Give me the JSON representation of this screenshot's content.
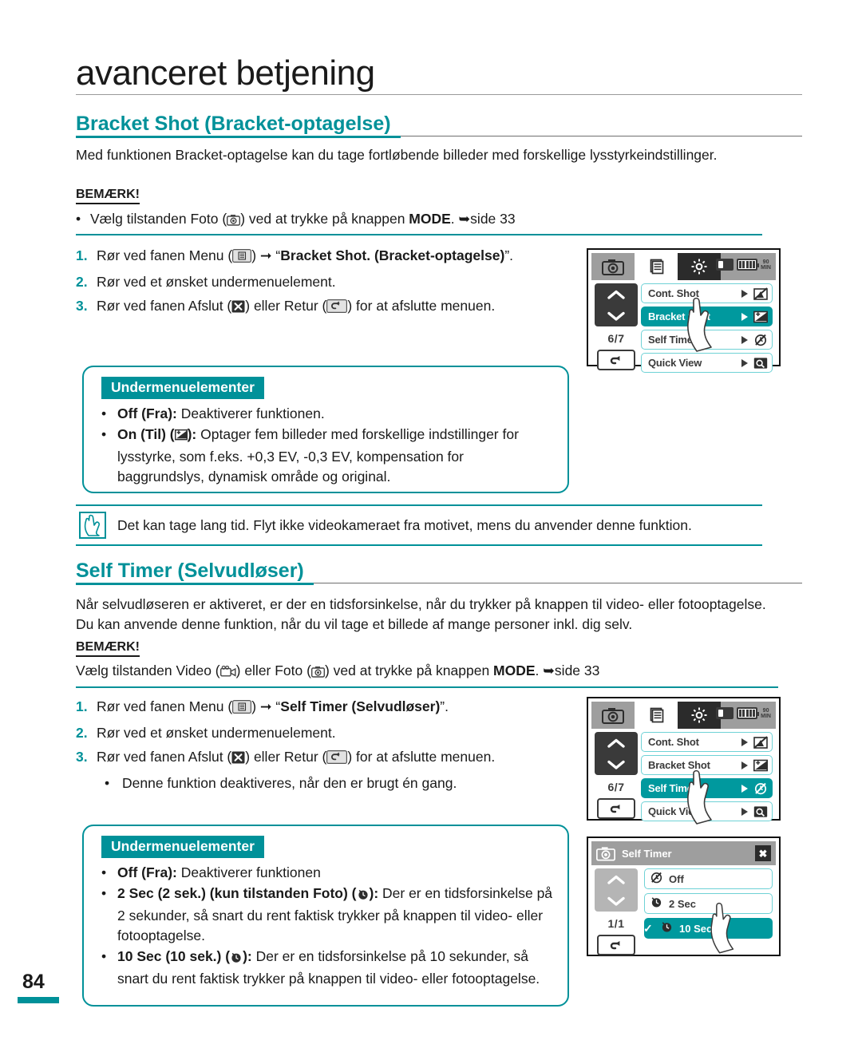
{
  "page": {
    "title": "avanceret betjening",
    "number": "84"
  },
  "section1": {
    "heading": "Bracket Shot (Bracket-optagelse)",
    "intro": "Med funktionen Bracket-optagelse kan du tage fortløbende billeder med forskellige lysstyrkeindstillinger.",
    "note_label": "BEMÆRK!",
    "note_bullet_pre": "Vælg tilstanden Foto (",
    "note_bullet_mid": ") ved at trykke på knappen ",
    "note_bullet_mode": "MODE",
    "note_bullet_post": ". ➥side 33",
    "steps": [
      {
        "num": "1.",
        "pre": "Rør ved fanen Menu (",
        "mid": ") ➞ “",
        "bold": "Bracket Shot. (Bracket-optagelse)",
        "post": "”."
      },
      {
        "num": "2.",
        "plain": "Rør ved et ønsket undermenuelement."
      },
      {
        "num": "3.",
        "pre3a": "Rør ved fanen Afslut (",
        "pre3b": ") eller Retur (",
        "pre3c": ") for at afslutte menuen."
      }
    ],
    "submenu": {
      "title": "Undermenuelementer",
      "items": [
        {
          "bold": "Off (Fra):",
          "text": " Deaktiverer funktionen."
        },
        {
          "bold": "On (Til) (",
          "icon": "exposure-icon",
          "bold2": "):",
          "text": " Optager fem billeder med forskellige indstillinger for lysstyrke, som f.eks. +0,3 EV, -0,3 EV, kompensation for baggrundslys, dynamisk område og original."
        }
      ]
    },
    "caution": "Det kan tage lang tid. Flyt ikke videokameraet fra motivet, mens du anvender denne funktion."
  },
  "section2": {
    "heading": "Self Timer (Selvudløser)",
    "intro": "Når selvudløseren er aktiveret, er der en tidsforsinkelse, når du trykker på knappen til video- eller fotooptagelse. Du kan anvende denne funktion, når du vil tage et billede af mange personer inkl. dig selv.",
    "note_label": "BEMÆRK!",
    "note_pre": "Vælg tilstanden Video (",
    "note_mid1": ") eller Foto (",
    "note_mid2": ") ved at trykke på knappen ",
    "note_mode": "MODE",
    "note_post": ". ➥side 33",
    "steps": [
      {
        "num": "1.",
        "pre": "Rør ved fanen Menu (",
        "mid": ") ➞ “",
        "bold": "Self Timer (Selvudløser)",
        "post": "”."
      },
      {
        "num": "2.",
        "plain": "Rør ved et ønsket undermenuelement."
      },
      {
        "num": "3.",
        "pre3a": "Rør ved fanen Afslut (",
        "pre3b": ") eller Retur (",
        "pre3c": ") for at afslutte menuen."
      }
    ],
    "sub_bullet": "Denne funktion deaktiveres, når den er brugt én gang.",
    "submenu": {
      "title": "Undermenuelementer",
      "items": [
        {
          "bold": "Off (Fra):",
          "text": " Deaktiverer funktionen"
        },
        {
          "bold": "2 Sec (2 sek.) (kun tilstanden Foto) (",
          "icon": "timer-2sec-icon",
          "bold2": "):",
          "text": " Der er en tidsforsinkelse på 2 sekunder, så snart du rent faktisk trykker på knappen til video- eller fotooptagelse."
        },
        {
          "bold": "10 Sec (10 sek.) (",
          "icon": "timer-10sec-icon",
          "bold2": "):",
          "text": " Der er en tidsforsinkelse på 10 sekunder, så snart du rent faktisk trykker på knappen til video- eller fotooptagelse."
        }
      ]
    }
  },
  "lcd1": {
    "tabs": [
      "camera-icon",
      "menu-icon",
      "gear-icon"
    ],
    "status": {
      "sd": "sd-card-icon",
      "battery": "battery-icon",
      "min": "MIN",
      "min_num": "90"
    },
    "page_count": "6/7",
    "rows": [
      {
        "label": "Cont. Shot",
        "selected": false,
        "icon": "cont-shot-off-icon"
      },
      {
        "label": "Bracket Shot",
        "selected": true,
        "icon": "bracket-shot-icon"
      },
      {
        "label": "Self Timer",
        "selected": false,
        "icon": "self-timer-off-icon"
      },
      {
        "label": "Quick View",
        "selected": false,
        "icon": "quick-view-icon"
      }
    ]
  },
  "lcd2": {
    "page_count": "6/7",
    "rows": [
      {
        "label": "Cont. Shot",
        "selected": false,
        "icon": "cont-shot-off-icon"
      },
      {
        "label": "Bracket Shot",
        "selected": false,
        "icon": "bracket-shot-icon"
      },
      {
        "label": "Self Timer",
        "selected": true,
        "icon": "self-timer-off-icon"
      },
      {
        "label": "Quick View",
        "selected": false,
        "icon": "quick-view-icon"
      }
    ]
  },
  "lcd3": {
    "dialog_title": "Self Timer",
    "close_label": "✖",
    "page_count": "1/1",
    "options": [
      {
        "label": "Off",
        "selected": false,
        "icon": "self-timer-off-icon",
        "checked": false
      },
      {
        "label": "2 Sec",
        "selected": false,
        "icon": "timer-2sec-icon",
        "checked": false
      },
      {
        "label": "10 Sec",
        "selected": true,
        "icon": "timer-10sec-icon",
        "checked": true
      }
    ]
  },
  "colors": {
    "accent": "#009199",
    "lcd_select": "#00999e",
    "lcd_border": "#6fd2d6",
    "dark": "#3a3a3a"
  }
}
